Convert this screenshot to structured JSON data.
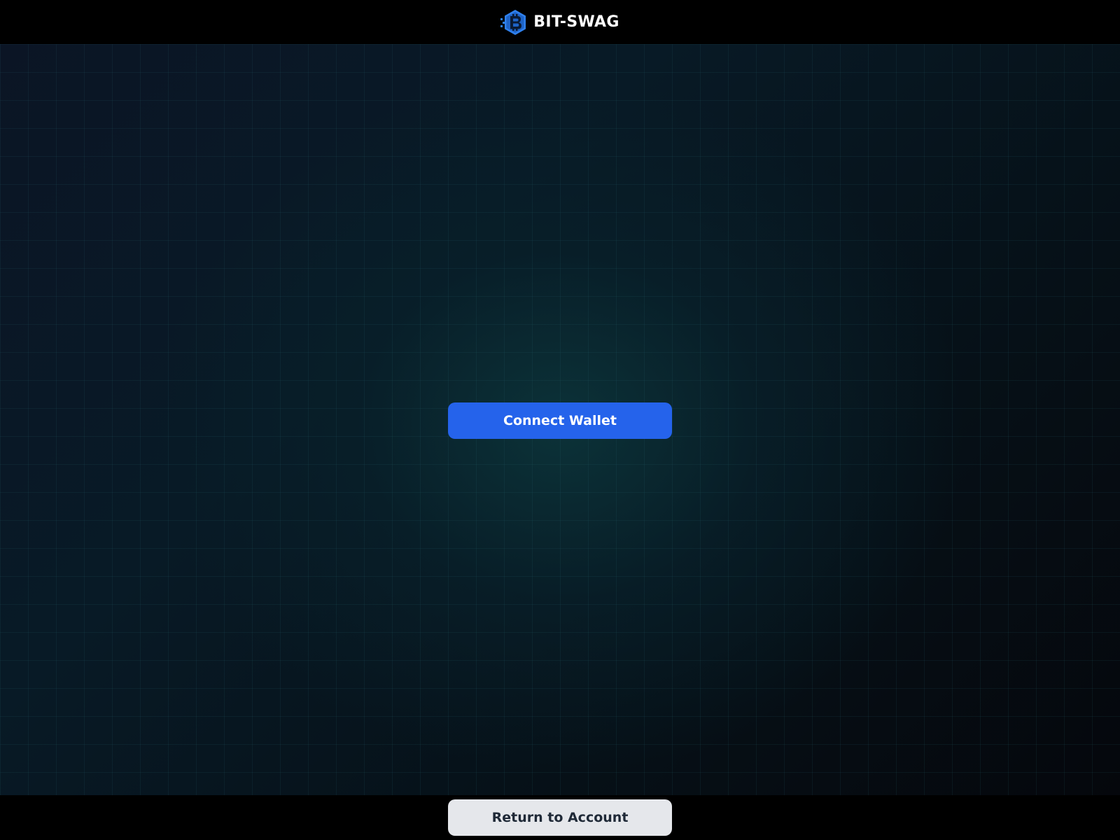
{
  "header": {
    "brand_name": "BIT-SWAG",
    "logo_icon": "hexagon-bitcoin-logo-icon"
  },
  "main": {
    "connect_wallet_label": "Connect Wallet"
  },
  "footer": {
    "return_label": "Return to Account"
  },
  "colors": {
    "header_bg": "#000000",
    "primary_button": "#2563eb",
    "secondary_button": "#e5e7eb",
    "secondary_button_text": "#1f2937",
    "logo_blue": "#2f80ed",
    "background_dark": "#061017"
  }
}
